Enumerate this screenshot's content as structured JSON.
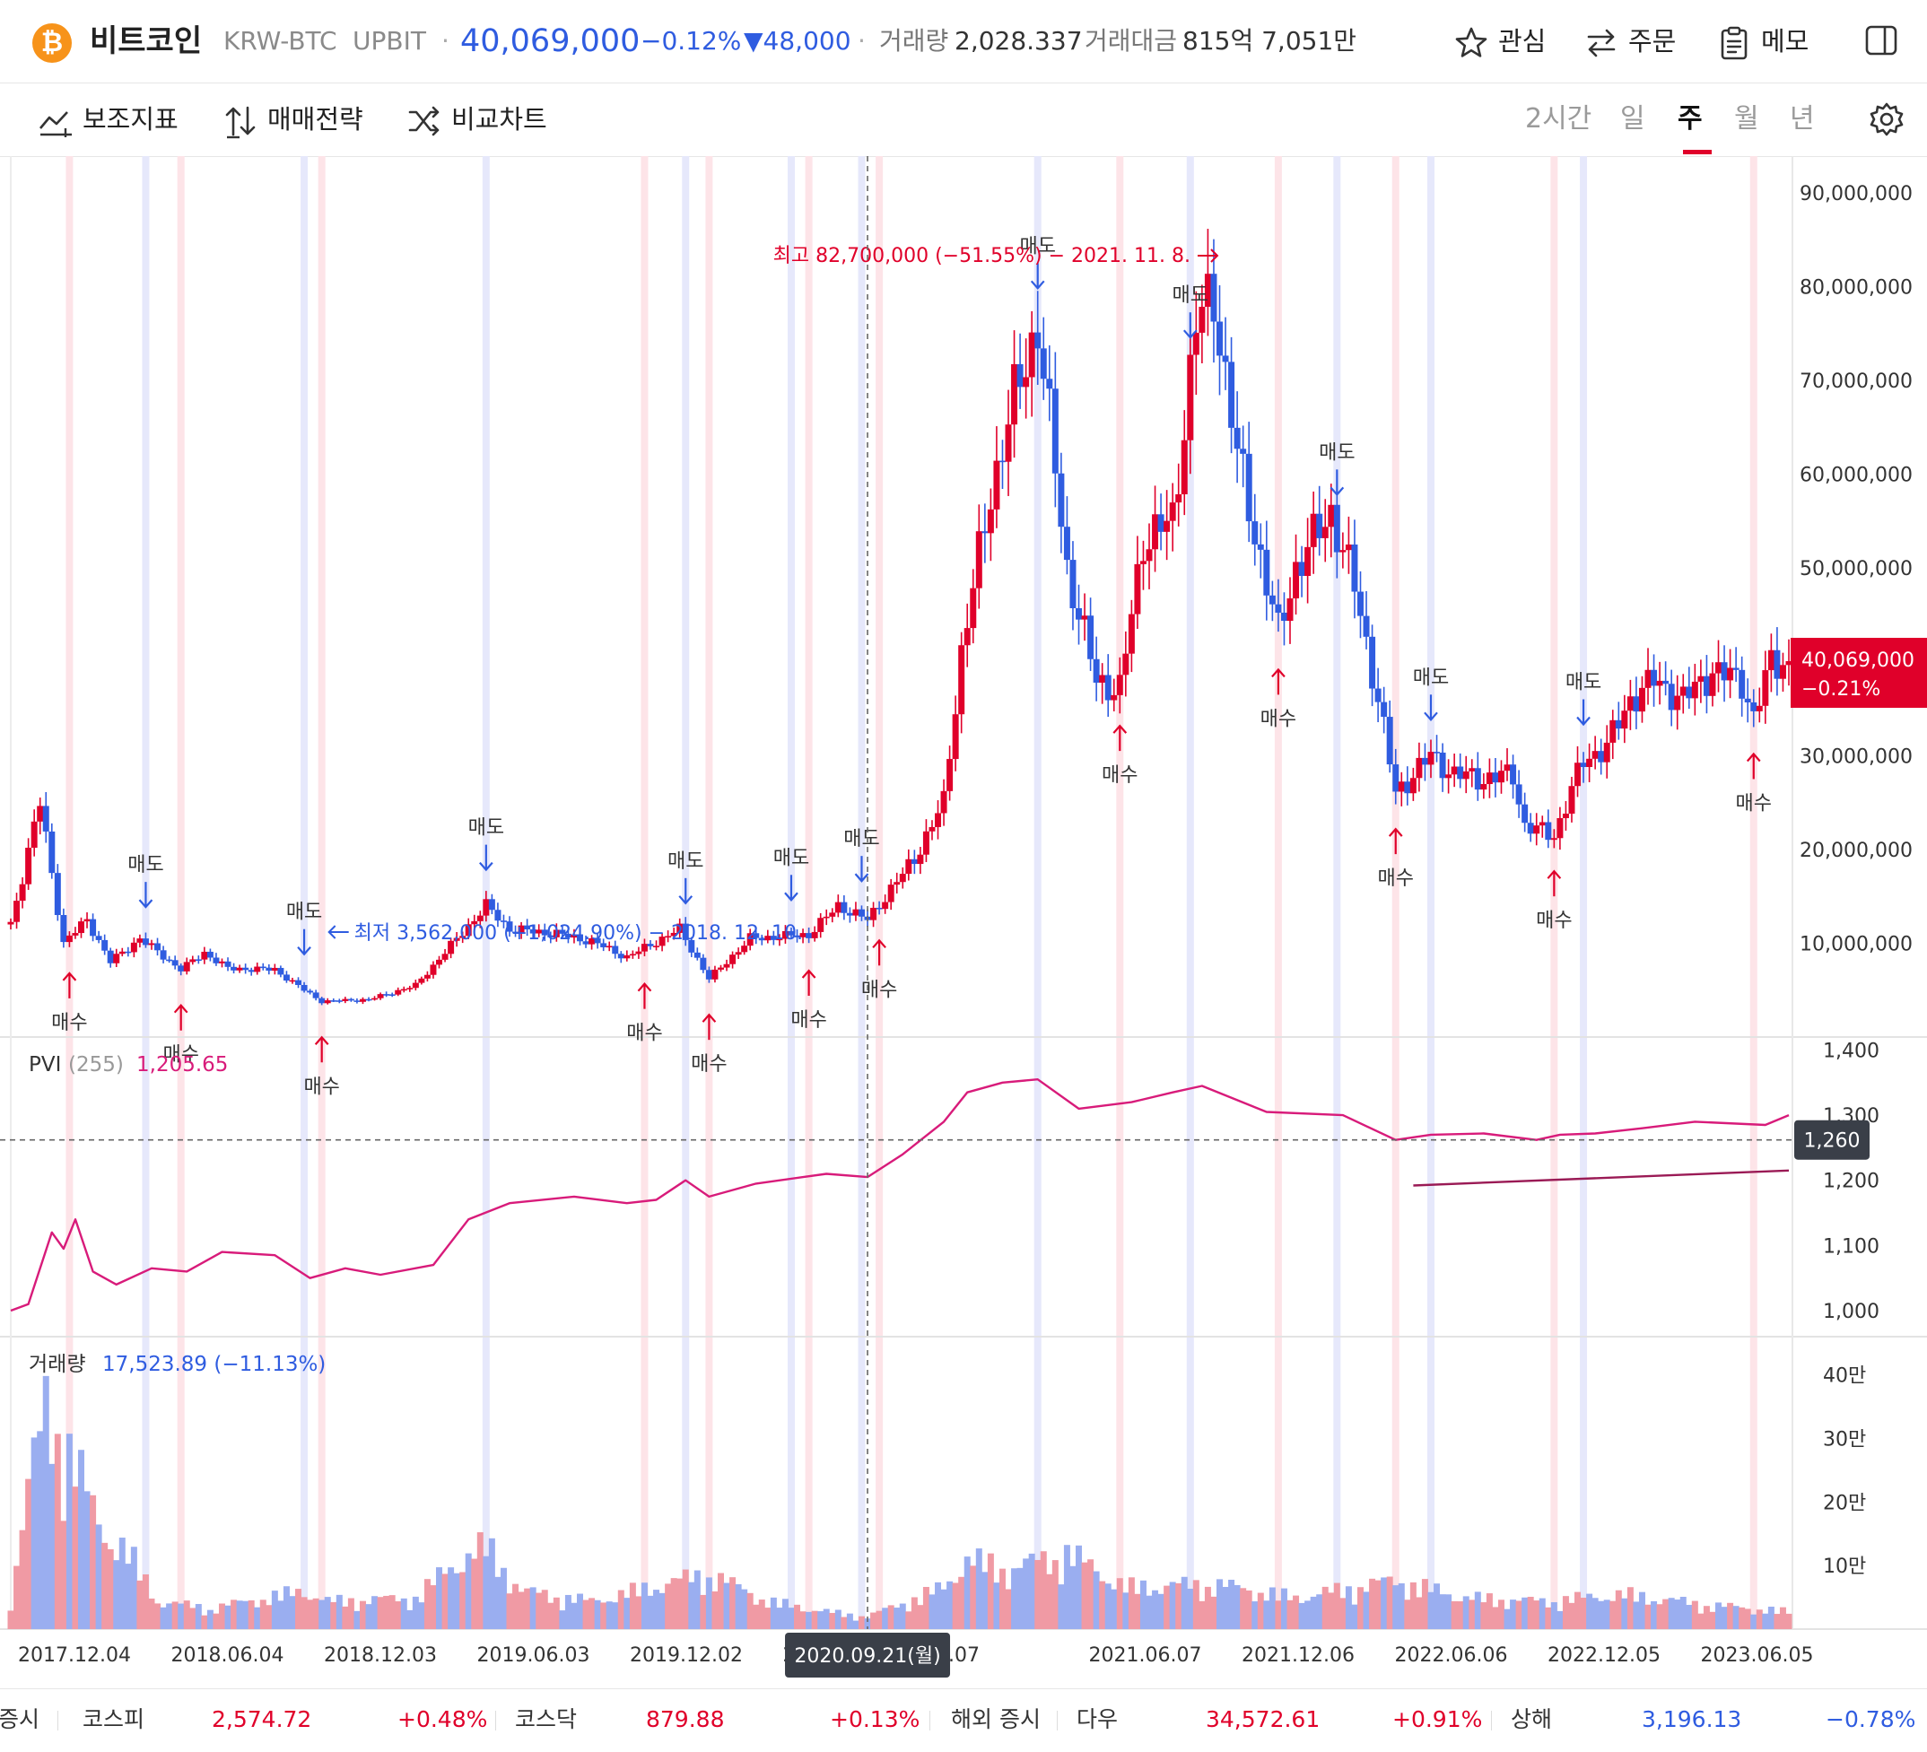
{
  "header": {
    "coin_icon": "bitcoin-icon",
    "name": "비트코인",
    "pair": "KRW-BTC",
    "exchange": "UPBIT",
    "dot": "·",
    "price": "40,069,000",
    "change_pct": "−0.12%",
    "change_amt": "▼48,000",
    "volume_label": "거래량",
    "volume_value": "2,028.337",
    "amount_label": "거래대금",
    "amount_value": "815억 7,051만",
    "buttons": {
      "watch": "관심",
      "order": "주문",
      "memo": "메모"
    },
    "icons": {
      "watch": "star-icon",
      "order": "swap-arrows-icon",
      "memo": "clipboard-icon",
      "panel": "side-panel-icon"
    }
  },
  "toolbar": {
    "indicators": "보조지표",
    "strategy": "매매전략",
    "compare": "비교차트",
    "periods": [
      "2시간",
      "일",
      "주",
      "월",
      "년"
    ],
    "active_period": "주",
    "settings_icon": "gear-icon"
  },
  "colors": {
    "up": "#e0002a",
    "down": "#2f5ce0",
    "pvi": "#d81b7a",
    "up_vol": "#f09aa4",
    "down_vol": "#9aaef0"
  },
  "chart_data": {
    "type": "candlestick",
    "price_axis": {
      "min": 0,
      "max": 92000000,
      "ticks": [
        "10,000,000",
        "20,000,000",
        "30,000,000",
        "40,000,000",
        "50,000,000",
        "60,000,000",
        "70,000,000",
        "80,000,000",
        "90,000,000"
      ]
    },
    "x_ticks": [
      "2017.12.04",
      "2018.06.04",
      "2018.12.03",
      "2019.06.03",
      "2019.12.02",
      "2020.0",
      "2.07",
      "2021.06.07",
      "2021.12.06",
      "2022.06.06",
      "2022.12.05",
      "2023.06.05"
    ],
    "current_price": {
      "value": "40,069,000",
      "change": "−0.21%"
    },
    "crosshair_label": "2020.09.21(월)",
    "high_annotation": "최고 82,700,000 (−51.55%) − 2021. 11. 8.",
    "low_annotation": "최저 3,562,000 (+1,024.90%) − 2018. 12. 10.",
    "buy_label": "매수",
    "sell_label": "매도",
    "buy_signals": [
      "2018.02.12",
      "2018.06.25",
      "2018.12.10",
      "2019.12.30",
      "2020.03.16",
      "2020.07.13",
      "2020.10.05",
      "2021.07.19",
      "2022.01.24",
      "2022.06.13",
      "2022.12.19",
      "2023.08.14"
    ],
    "sell_signals": [
      "2018.05.14",
      "2018.11.19",
      "2019.06.24",
      "2020.02.17",
      "2020.06.22",
      "2020.09.14",
      "2021.04.12",
      "2021.10.11",
      "2022.04.04",
      "2022.07.25",
      "2023.01.23"
    ],
    "price_path": [
      [
        "2017.12.04",
        12000000
      ],
      [
        "2018.01.08",
        25000000
      ],
      [
        "2018.02.05",
        10000000
      ],
      [
        "2018.03.05",
        12500000
      ],
      [
        "2018.04.02",
        8000000
      ],
      [
        "2018.05.07",
        10500000
      ],
      [
        "2018.06.25",
        7200000
      ],
      [
        "2018.07.23",
        9000000
      ],
      [
        "2018.08.20",
        7300000
      ],
      [
        "2018.10.15",
        7200000
      ],
      [
        "2018.11.19",
        5000000
      ],
      [
        "2018.12.10",
        3800000
      ],
      [
        "2019.02.04",
        4000000
      ],
      [
        "2019.04.01",
        5500000
      ],
      [
        "2019.06.24",
        14000000
      ],
      [
        "2019.07.22",
        11500000
      ],
      [
        "2019.09.16",
        11000000
      ],
      [
        "2019.10.28",
        10200000
      ],
      [
        "2019.12.09",
        8500000
      ],
      [
        "2020.02.10",
        11500000
      ],
      [
        "2020.03.16",
        6200000
      ],
      [
        "2020.05.04",
        10500000
      ],
      [
        "2020.07.13",
        10900000
      ],
      [
        "2020.08.17",
        14000000
      ],
      [
        "2020.09.21",
        12500000
      ],
      [
        "2020.11.16",
        19000000
      ],
      [
        "2020.12.21",
        25000000
      ],
      [
        "2021.01.11",
        41000000
      ],
      [
        "2021.02.15",
        58000000
      ],
      [
        "2021.03.15",
        68000000
      ],
      [
        "2021.04.12",
        76000000
      ],
      [
        "2021.05.17",
        50000000
      ],
      [
        "2021.06.21",
        38000000
      ],
      [
        "2021.07.19",
        37000000
      ],
      [
        "2021.08.16",
        53000000
      ],
      [
        "2021.09.20",
        55000000
      ],
      [
        "2021.10.18",
        76000000
      ],
      [
        "2021.11.08",
        79000000
      ],
      [
        "2021.12.06",
        62000000
      ],
      [
        "2022.01.24",
        43000000
      ],
      [
        "2022.02.14",
        50000000
      ],
      [
        "2022.03.28",
        56000000
      ],
      [
        "2022.04.25",
        48000000
      ],
      [
        "2022.05.23",
        36000000
      ],
      [
        "2022.06.13",
        26000000
      ],
      [
        "2022.07.25",
        30000000
      ],
      [
        "2022.08.22",
        28000000
      ],
      [
        "2022.09.26",
        27500000
      ],
      [
        "2022.10.31",
        28000000
      ],
      [
        "2022.11.14",
        22500000
      ],
      [
        "2022.12.19",
        21500000
      ],
      [
        "2023.01.23",
        29500000
      ],
      [
        "2023.02.20",
        31000000
      ],
      [
        "2023.03.20",
        36000000
      ],
      [
        "2023.04.17",
        38000000
      ],
      [
        "2023.05.22",
        36000000
      ],
      [
        "2023.06.26",
        39000000
      ],
      [
        "2023.07.31",
        38000000
      ],
      [
        "2023.08.14",
        34000000
      ],
      [
        "2023.09.04",
        40000000
      ],
      [
        "2023.09.25",
        40069000
      ]
    ],
    "pvi": {
      "name": "PVI",
      "param": "(255)",
      "value": "1,205.65",
      "axis": {
        "min": 960,
        "max": 1420,
        "ticks": [
          "1,000",
          "1,100",
          "1,200",
          "1,300",
          "1,400"
        ]
      },
      "crosshair_value": "1,260",
      "path": [
        [
          "2017.12.04",
          1000
        ],
        [
          "2017.12.25",
          1010
        ],
        [
          "2018.01.22",
          1120
        ],
        [
          "2018.02.05",
          1095
        ],
        [
          "2018.02.19",
          1140
        ],
        [
          "2018.03.12",
          1060
        ],
        [
          "2018.04.09",
          1040
        ],
        [
          "2018.05.21",
          1065
        ],
        [
          "2018.07.02",
          1060
        ],
        [
          "2018.08.13",
          1090
        ],
        [
          "2018.10.15",
          1085
        ],
        [
          "2018.11.26",
          1050
        ],
        [
          "2019.01.07",
          1065
        ],
        [
          "2019.02.18",
          1055
        ],
        [
          "2019.04.22",
          1070
        ],
        [
          "2019.06.03",
          1140
        ],
        [
          "2019.07.22",
          1165
        ],
        [
          "2019.10.07",
          1175
        ],
        [
          "2019.12.09",
          1165
        ],
        [
          "2020.01.13",
          1170
        ],
        [
          "2020.02.17",
          1200
        ],
        [
          "2020.03.16",
          1175
        ],
        [
          "2020.05.11",
          1195
        ],
        [
          "2020.08.03",
          1210
        ],
        [
          "2020.09.21",
          1205
        ],
        [
          "2020.11.02",
          1240
        ],
        [
          "2020.12.21",
          1290
        ],
        [
          "2021.01.18",
          1335
        ],
        [
          "2021.03.01",
          1350
        ],
        [
          "2021.04.12",
          1355
        ],
        [
          "2021.05.31",
          1310
        ],
        [
          "2021.08.02",
          1320
        ],
        [
          "2021.09.20",
          1335
        ],
        [
          "2021.10.25",
          1345
        ],
        [
          "2022.01.10",
          1305
        ],
        [
          "2022.04.11",
          1300
        ],
        [
          "2022.06.13",
          1262
        ],
        [
          "2022.07.25",
          1270
        ],
        [
          "2022.09.26",
          1272
        ],
        [
          "2022.11.28",
          1262
        ],
        [
          "2022.12.26",
          1270
        ],
        [
          "2023.02.06",
          1272
        ],
        [
          "2023.04.03",
          1280
        ],
        [
          "2023.06.05",
          1290
        ],
        [
          "2023.08.28",
          1285
        ],
        [
          "2023.09.25",
          1300
        ]
      ],
      "signal_path": [
        [
          "2022.07.04",
          1192
        ],
        [
          "2023.09.25",
          1215
        ]
      ]
    },
    "volume": {
      "name": "거래량",
      "value": "17,523.89 (−11.13%)",
      "axis": {
        "min": 0,
        "max": 460000,
        "ticks": [
          "10만",
          "20만",
          "30만",
          "40만"
        ]
      },
      "profile": [
        [
          "2017.12.04",
          40000
        ],
        [
          "2017.12.25",
          200000
        ],
        [
          "2018.01.15",
          320000
        ],
        [
          "2018.02.12",
          260000
        ],
        [
          "2018.03.19",
          150000
        ],
        [
          "2018.04.23",
          110000
        ],
        [
          "2018.05.28",
          40000
        ],
        [
          "2018.07.30",
          30000
        ],
        [
          "2018.11.19",
          55000
        ],
        [
          "2018.12.17",
          40000
        ],
        [
          "2019.04.01",
          45000
        ],
        [
          "2019.05.13",
          90000
        ],
        [
          "2019.06.24",
          120000
        ],
        [
          "2019.08.05",
          55000
        ],
        [
          "2019.10.28",
          40000
        ],
        [
          "2020.03.16",
          80000
        ],
        [
          "2020.05.25",
          40000
        ],
        [
          "2020.08.03",
          25000
        ],
        [
          "2020.09.21",
          18000
        ],
        [
          "2020.12.21",
          60000
        ],
        [
          "2021.01.18",
          100000
        ],
        [
          "2021.03.08",
          85000
        ],
        [
          "2021.05.17",
          110000
        ],
        [
          "2021.07.26",
          60000
        ],
        [
          "2021.11.08",
          65000
        ],
        [
          "2022.02.14",
          45000
        ],
        [
          "2022.06.13",
          70000
        ],
        [
          "2022.09.05",
          45000
        ],
        [
          "2022.12.05",
          40000
        ],
        [
          "2023.03.13",
          50000
        ],
        [
          "2023.06.19",
          35000
        ],
        [
          "2023.09.25",
          25000
        ]
      ]
    }
  },
  "footer": {
    "domestic_label": "증시",
    "kospi_name": "코스피",
    "kospi_value": "2,574.72",
    "kospi_change": "+0.48%",
    "kosdaq_name": "코스닥",
    "kosdaq_value": "879.88",
    "kosdaq_change": "+0.13%",
    "overseas_label": "해외 증시",
    "dow_name": "다우",
    "dow_value": "34,572.61",
    "dow_change": "+0.91%",
    "shanghai_name": "상해",
    "shanghai_value": "3,196.13",
    "shanghai_change": "−0.78%"
  }
}
